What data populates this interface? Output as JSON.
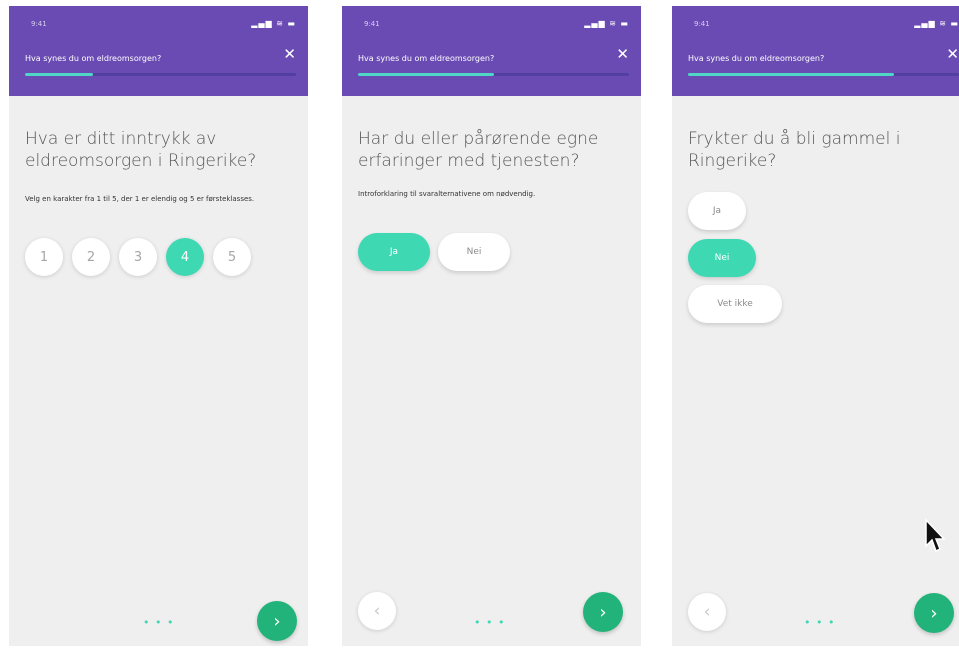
{
  "colors": {
    "header": "#6a4bb3",
    "accent": "#3ed8b3",
    "next_button": "#22b37a",
    "background": "#efefef"
  },
  "screens": [
    {
      "status_time": "9:41",
      "header_title": "Hva synes du om eldreomsorgen?",
      "progress": 0.25,
      "question": "Hva er ditt inntrykk av eldreomsorgen i Ringerike?",
      "helper": "Velg en karakter fra 1 til 5, der 1 er elendig og 5 er førsteklasses.",
      "ratings": [
        "1",
        "2",
        "3",
        "4",
        "5"
      ],
      "selected_rating": "4",
      "dots": "• • •",
      "next_icon": "chevron-right-icon"
    },
    {
      "status_time": "9:41",
      "header_title": "Hva synes du om eldreomsorgen?",
      "progress": 0.5,
      "question": "Har du eller pårørende egne erfaringer med tjenesten?",
      "helper": "Introforklaring til svaralternativene om nødvendig.",
      "options": [
        "Ja",
        "Nei"
      ],
      "selected_option": "Ja",
      "dots": "• • •",
      "back_icon": "chevron-left-icon",
      "next_icon": "chevron-right-icon"
    },
    {
      "status_time": "9:41",
      "header_title": "Hva synes du om eldreomsorgen?",
      "progress": 0.76,
      "question": "Frykter du å bli gammel i Ringerike?",
      "options": [
        "Ja",
        "Nei",
        "Vet ikke"
      ],
      "selected_option": "Nei",
      "dots": "• • •",
      "back_icon": "chevron-left-icon",
      "next_icon": "chevron-right-icon"
    }
  ]
}
